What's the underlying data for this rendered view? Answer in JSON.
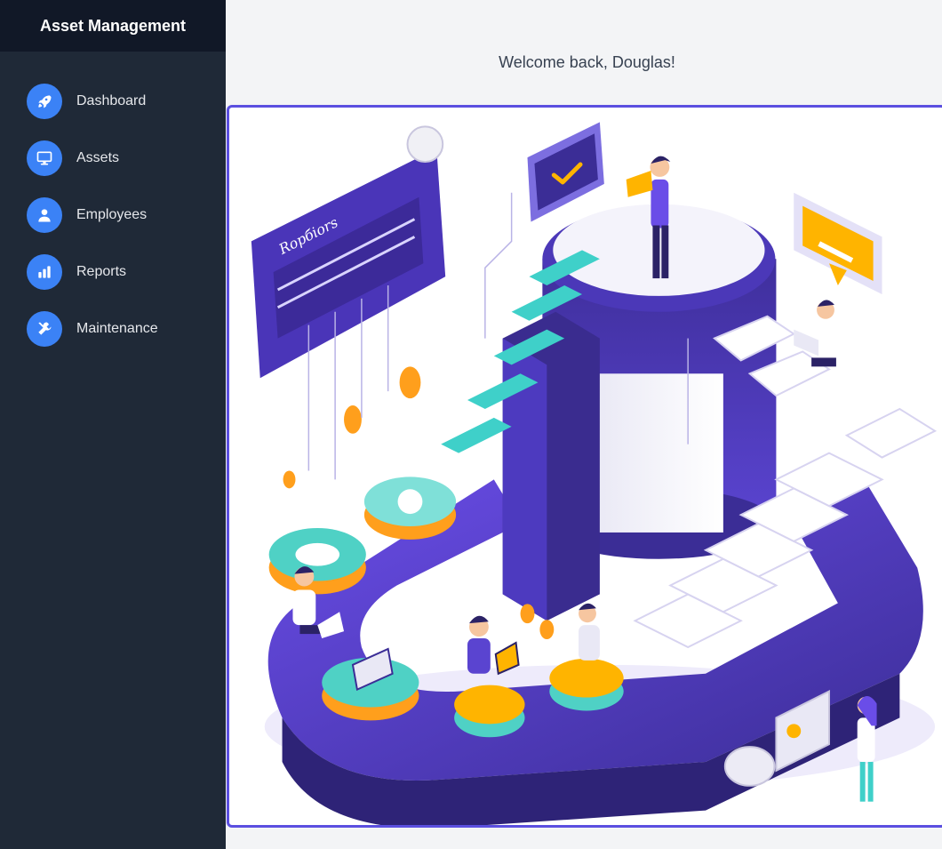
{
  "app": {
    "title": "Asset Management"
  },
  "sidebar": {
    "items": [
      {
        "label": "Dashboard",
        "icon": "rocket-icon"
      },
      {
        "label": "Assets",
        "icon": "monitor-icon"
      },
      {
        "label": "Employees",
        "icon": "user-icon"
      },
      {
        "label": "Reports",
        "icon": "bar-chart-icon"
      },
      {
        "label": "Maintenance",
        "icon": "wrench-screwdriver-icon"
      }
    ]
  },
  "main": {
    "welcome": "Welcome back, Douglas!",
    "illustration": {
      "icon": "isometric-team-illustration",
      "board_text": "Rорбiоrs"
    }
  },
  "colors": {
    "sidebar_bg": "#1f2937",
    "sidebar_header_bg": "#111827",
    "accent": "#3b82f6",
    "hero_border": "#5b4fe0",
    "main_bg": "#f3f4f6"
  }
}
